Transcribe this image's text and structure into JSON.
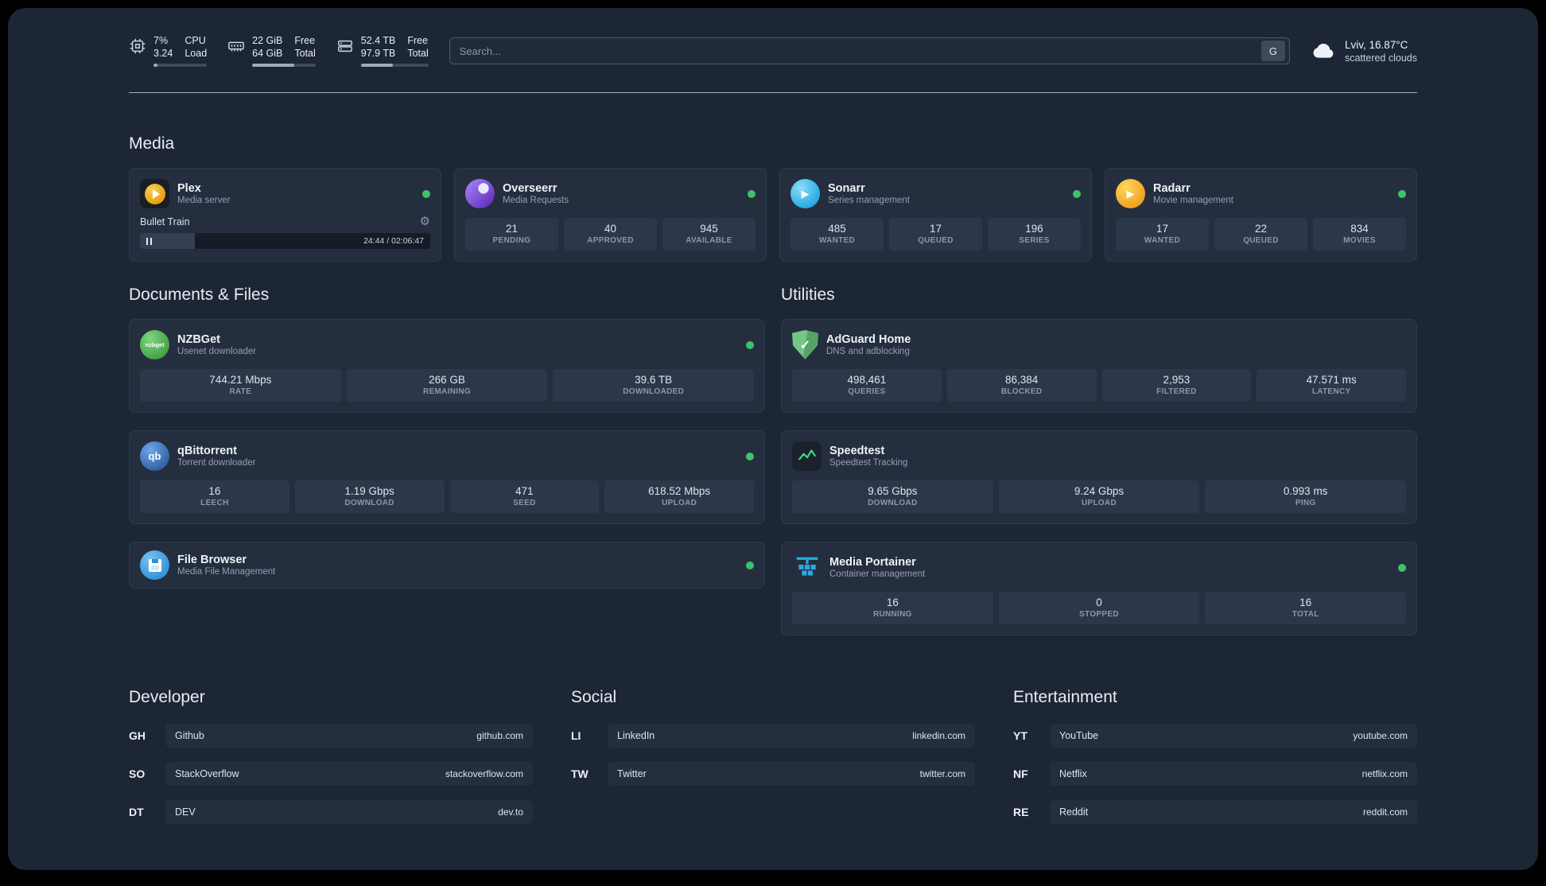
{
  "topbar": {
    "cpu": {
      "value_top": "7%",
      "value_bottom": "3.24",
      "label_top": "CPU",
      "label_bottom": "Load",
      "progress": 7
    },
    "ram": {
      "value_top": "22 GiB",
      "value_bottom": "64 GiB",
      "label_top": "Free",
      "label_bottom": "Total",
      "progress": 66
    },
    "disk": {
      "value_top": "52.4 TB",
      "value_bottom": "97.9 TB",
      "label_top": "Free",
      "label_bottom": "Total",
      "progress": 47
    },
    "search": {
      "placeholder": "Search...",
      "button_label": "G"
    },
    "weather": {
      "location": "Lviv, 16.87°C",
      "condition": "scattered clouds"
    }
  },
  "media": {
    "title": "Media",
    "plex": {
      "title": "Plex",
      "subtitle": "Media server",
      "now_playing": "Bullet Train",
      "time": "24:44 / 02:06:47",
      "progress": 19
    },
    "overseerr": {
      "title": "Overseerr",
      "subtitle": "Media Requests",
      "stats": [
        {
          "value": "21",
          "label": "PENDING"
        },
        {
          "value": "40",
          "label": "APPROVED"
        },
        {
          "value": "945",
          "label": "AVAILABLE"
        }
      ]
    },
    "sonarr": {
      "title": "Sonarr",
      "subtitle": "Series management",
      "play_glyph": "▶",
      "stats": [
        {
          "value": "485",
          "label": "WANTED"
        },
        {
          "value": "17",
          "label": "QUEUED"
        },
        {
          "value": "196",
          "label": "SERIES"
        }
      ]
    },
    "radarr": {
      "title": "Radarr",
      "subtitle": "Movie management",
      "play_glyph": "▶",
      "stats": [
        {
          "value": "17",
          "label": "WANTED"
        },
        {
          "value": "22",
          "label": "QUEUED"
        },
        {
          "value": "834",
          "label": "MOVIES"
        }
      ]
    }
  },
  "documents": {
    "title": "Documents & Files",
    "nzbget": {
      "title": "NZBGet",
      "subtitle": "Usenet downloader",
      "logo_text": "nzbget",
      "stats": [
        {
          "value": "744.21 Mbps",
          "label": "RATE"
        },
        {
          "value": "266 GB",
          "label": "REMAINING"
        },
        {
          "value": "39.6 TB",
          "label": "DOWNLOADED"
        }
      ]
    },
    "qbittorrent": {
      "title": "qBittorrent",
      "subtitle": "Torrent downloader",
      "logo_text": "qb",
      "stats": [
        {
          "value": "16",
          "label": "LEECH"
        },
        {
          "value": "1.19 Gbps",
          "label": "DOWNLOAD"
        },
        {
          "value": "471",
          "label": "SEED"
        },
        {
          "value": "618.52 Mbps",
          "label": "UPLOAD"
        }
      ]
    },
    "filebrowser": {
      "title": "File Browser",
      "subtitle": "Media File Management"
    }
  },
  "utilities": {
    "title": "Utilities",
    "adguard": {
      "title": "AdGuard Home",
      "subtitle": "DNS and adblocking",
      "check_glyph": "✓",
      "stats": [
        {
          "value": "498,461",
          "label": "QUERIES"
        },
        {
          "value": "86,384",
          "label": "BLOCKED"
        },
        {
          "value": "2,953",
          "label": "FILTERED"
        },
        {
          "value": "47.571 ms",
          "label": "LATENCY"
        }
      ]
    },
    "speedtest": {
      "title": "Speedtest",
      "subtitle": "Speedtest Tracking",
      "stats": [
        {
          "value": "9.65 Gbps",
          "label": "DOWNLOAD"
        },
        {
          "value": "9.24 Gbps",
          "label": "UPLOAD"
        },
        {
          "value": "0.993 ms",
          "label": "PING"
        }
      ]
    },
    "portainer": {
      "title": "Media Portainer",
      "subtitle": "Container management",
      "stats": [
        {
          "value": "16",
          "label": "RUNNING"
        },
        {
          "value": "0",
          "label": "STOPPED"
        },
        {
          "value": "16",
          "label": "TOTAL"
        }
      ]
    }
  },
  "bookmarks": {
    "developer": {
      "title": "Developer",
      "items": [
        {
          "abbr": "GH",
          "name": "Github",
          "url": "github.com"
        },
        {
          "abbr": "SO",
          "name": "StackOverflow",
          "url": "stackoverflow.com"
        },
        {
          "abbr": "DT",
          "name": "DEV",
          "url": "dev.to"
        }
      ]
    },
    "social": {
      "title": "Social",
      "items": [
        {
          "abbr": "LI",
          "name": "LinkedIn",
          "url": "linkedin.com"
        },
        {
          "abbr": "TW",
          "name": "Twitter",
          "url": "twitter.com"
        }
      ]
    },
    "entertainment": {
      "title": "Entertainment",
      "items": [
        {
          "abbr": "YT",
          "name": "YouTube",
          "url": "youtube.com"
        },
        {
          "abbr": "NF",
          "name": "Netflix",
          "url": "netflix.com"
        },
        {
          "abbr": "RE",
          "name": "Reddit",
          "url": "reddit.com"
        }
      ]
    }
  }
}
